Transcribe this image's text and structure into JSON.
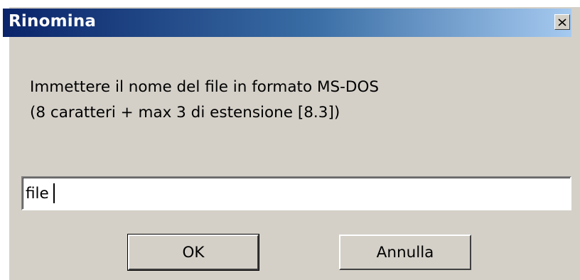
{
  "dialog": {
    "title": "Rinomina",
    "close_icon": "close-icon",
    "message_line1": "Immettere il nome del file in formato MS-DOS",
    "message_line2": "(8 caratteri + max 3 di estensione [8.3])",
    "input_value": "file",
    "ok_label": "OK",
    "cancel_label": "Annulla"
  },
  "colors": {
    "title_bar_start": "#0a246a",
    "title_bar_end": "#a6caf0",
    "dialog_face": "#d4d0c8"
  }
}
